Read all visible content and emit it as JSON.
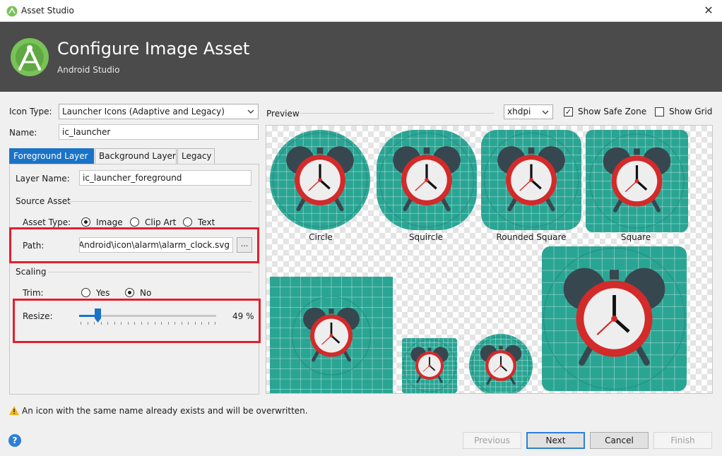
{
  "window": {
    "title": "Asset Studio",
    "close_glyph": "✕"
  },
  "header": {
    "title": "Configure Image Asset",
    "subtitle": "Android Studio"
  },
  "icon_type": {
    "label": "Icon Type:",
    "value": "Launcher Icons (Adaptive and Legacy)"
  },
  "name": {
    "label": "Name:",
    "value": "ic_launcher"
  },
  "tabs": [
    "Foreground Layer",
    "Background Layer",
    "Legacy"
  ],
  "layer_name": {
    "label": "Layer Name:",
    "value": "ic_launcher_foreground"
  },
  "source_asset": {
    "section": "Source Asset",
    "asset_type_label": "Asset Type:",
    "asset_types": [
      "Image",
      "Clip Art",
      "Text"
    ],
    "asset_type_selected": "Image",
    "path_label": "Path:",
    "path_value": "Android\\icon\\alarm\\alarm_clock.svg",
    "browse_label": "..."
  },
  "scaling": {
    "section": "Scaling",
    "trim_label": "Trim:",
    "trim_options": [
      "Yes",
      "No"
    ],
    "trim_selected": "No",
    "resize_label": "Resize:",
    "resize_value": 49,
    "resize_text": "49 %"
  },
  "preview": {
    "label": "Preview",
    "density": "xhdpi",
    "show_safe_zone_label": "Show Safe Zone",
    "show_safe_zone": true,
    "show_grid_label": "Show Grid",
    "show_grid": false,
    "shapes": [
      "Circle",
      "Squircle",
      "Rounded Square",
      "Square"
    ]
  },
  "warning": "An icon with the same name already exists and will be overwritten.",
  "buttons": {
    "previous": "Previous",
    "next": "Next",
    "cancel": "Cancel",
    "finish": "Finish",
    "help": "?"
  },
  "colors": {
    "teal": "#2aa594",
    "red": "#d32a2a",
    "header_bg": "#4b4b4b",
    "accent": "#1a73c7",
    "highlight": "#e3202d"
  }
}
